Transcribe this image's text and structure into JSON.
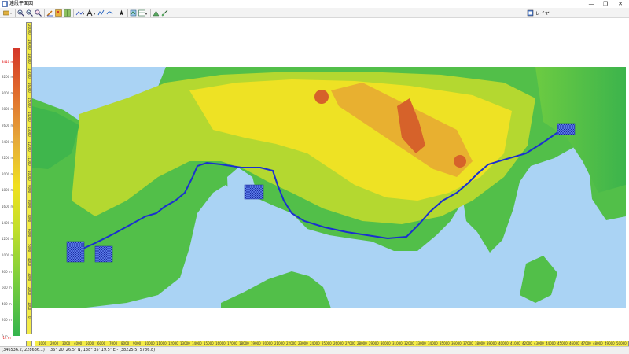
{
  "window": {
    "title": "連段平面図",
    "minimize": "—",
    "maximize": "❐",
    "close": "✕"
  },
  "toolbar": {
    "layer_label": "レイヤー",
    "icons": [
      "layers-icon",
      "zoom-in-icon",
      "zoom-out-icon",
      "zoom-fit-icon",
      "edit-line-icon",
      "grid-icon",
      "grid-alt-icon",
      "arrow-icon",
      "route-icon",
      "text-icon",
      "polyline-icon",
      "curve-icon",
      "north-icon",
      "pan-icon",
      "table-icon",
      "export-icon",
      "scale-icon"
    ]
  },
  "legend": {
    "max_label": "3410 m",
    "min_label": "-14 m",
    "labels": [
      "3200 m",
      "3000 m",
      "2800 m",
      "2600 m",
      "2400 m",
      "2200 m",
      "2000 m",
      "1800 m",
      "1600 m",
      "1400 m",
      "1200 m",
      "1000 m",
      "800 m",
      "600 m",
      "400 m",
      "200 m",
      "0 m"
    ],
    "colors": {
      "high": "#d4372a",
      "mid": "#f0e020",
      "low": "#35b44d"
    }
  },
  "ruler_h": {
    "ticks": [
      "1000",
      "2000",
      "3000",
      "4000",
      "5000",
      "6000",
      "7000",
      "8000",
      "9000",
      "10000",
      "11000",
      "12000",
      "13000",
      "14000",
      "15000",
      "16000",
      "17000",
      "18000",
      "19000",
      "20000",
      "21000",
      "22000",
      "23000",
      "24000",
      "25000",
      "26000",
      "27000",
      "28000",
      "29000",
      "30000",
      "31000",
      "32000",
      "33000",
      "34000",
      "35000",
      "36000",
      "37000",
      "38000",
      "39000",
      "40000",
      "41000",
      "42000",
      "43000",
      "44000",
      "45000",
      "46000",
      "47000",
      "48000",
      "49000",
      "50000"
    ]
  },
  "ruler_v": {
    "ticks": [
      "20000",
      "19000",
      "18000",
      "17000",
      "16000",
      "15000",
      "14000",
      "13000",
      "12000",
      "11000",
      "10000",
      "9000",
      "8000",
      "7000",
      "6000",
      "5000",
      "4000",
      "3000",
      "2000",
      "1000",
      "0"
    ]
  },
  "map": {
    "colors": {
      "water": "#aad3f4",
      "route": "#1a30d0",
      "marker": "#2a4ad8"
    }
  },
  "status": {
    "cursor_xy": "(346536.2, 228636.1)",
    "latlon": "36° 20' 26.5\" N, 138° 35' 19.5\" E - (38225.5, 5786.8)"
  }
}
